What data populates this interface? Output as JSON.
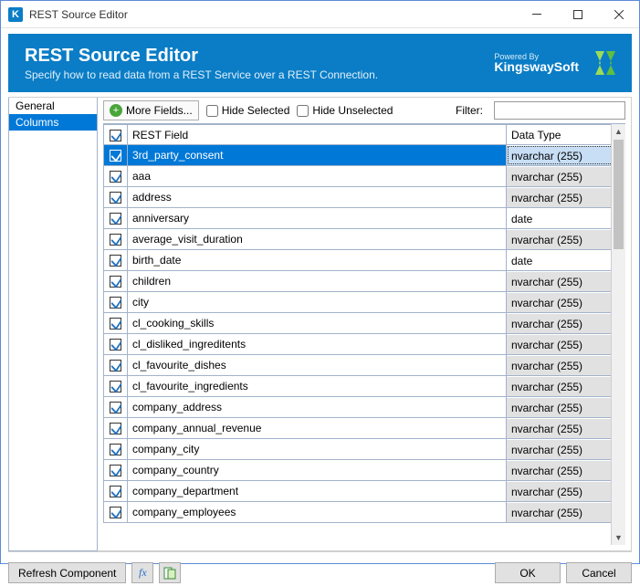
{
  "window": {
    "title": "REST Source Editor"
  },
  "header": {
    "title": "REST Source Editor",
    "subtitle": "Specify how to read data from a REST Service over a REST Connection.",
    "powered_by": "Powered By",
    "brand": "KingswaySoft"
  },
  "sidebar": {
    "items": [
      {
        "label": "General",
        "selected": false
      },
      {
        "label": "Columns",
        "selected": true
      }
    ]
  },
  "toolbar": {
    "more_fields": "More Fields...",
    "hide_selected": "Hide Selected",
    "hide_unselected": "Hide Unselected",
    "filter_label": "Filter:",
    "filter_value": ""
  },
  "grid": {
    "headers": {
      "field": "REST Field",
      "type": "Data Type"
    },
    "rows": [
      {
        "field": "3rd_party_consent",
        "type": "nvarchar (255)",
        "checked": true,
        "selected": true,
        "flat": false
      },
      {
        "field": "aaa",
        "type": "nvarchar (255)",
        "checked": true,
        "selected": false,
        "flat": false
      },
      {
        "field": "address",
        "type": "nvarchar (255)",
        "checked": true,
        "selected": false,
        "flat": false
      },
      {
        "field": "anniversary",
        "type": "date",
        "checked": true,
        "selected": false,
        "flat": true
      },
      {
        "field": "average_visit_duration",
        "type": "nvarchar (255)",
        "checked": true,
        "selected": false,
        "flat": false
      },
      {
        "field": "birth_date",
        "type": "date",
        "checked": true,
        "selected": false,
        "flat": true
      },
      {
        "field": "children",
        "type": "nvarchar (255)",
        "checked": true,
        "selected": false,
        "flat": false
      },
      {
        "field": "city",
        "type": "nvarchar (255)",
        "checked": true,
        "selected": false,
        "flat": false
      },
      {
        "field": "cl_cooking_skills",
        "type": "nvarchar (255)",
        "checked": true,
        "selected": false,
        "flat": false
      },
      {
        "field": "cl_disliked_ingreditents",
        "type": "nvarchar (255)",
        "checked": true,
        "selected": false,
        "flat": false
      },
      {
        "field": "cl_favourite_dishes",
        "type": "nvarchar (255)",
        "checked": true,
        "selected": false,
        "flat": false
      },
      {
        "field": "cl_favourite_ingredients",
        "type": "nvarchar (255)",
        "checked": true,
        "selected": false,
        "flat": false
      },
      {
        "field": "company_address",
        "type": "nvarchar (255)",
        "checked": true,
        "selected": false,
        "flat": false
      },
      {
        "field": "company_annual_revenue",
        "type": "nvarchar (255)",
        "checked": true,
        "selected": false,
        "flat": false
      },
      {
        "field": "company_city",
        "type": "nvarchar (255)",
        "checked": true,
        "selected": false,
        "flat": false
      },
      {
        "field": "company_country",
        "type": "nvarchar (255)",
        "checked": true,
        "selected": false,
        "flat": false
      },
      {
        "field": "company_department",
        "type": "nvarchar (255)",
        "checked": true,
        "selected": false,
        "flat": false
      },
      {
        "field": "company_employees",
        "type": "nvarchar (255)",
        "checked": true,
        "selected": false,
        "flat": false
      }
    ]
  },
  "footer": {
    "refresh": "Refresh Component",
    "ok": "OK",
    "cancel": "Cancel"
  }
}
